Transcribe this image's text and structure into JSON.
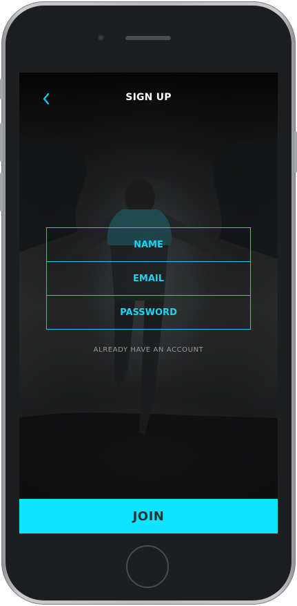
{
  "header": {
    "title": "SIGN UP",
    "back_icon": "chevron-left-icon"
  },
  "form": {
    "name_placeholder": "NAME",
    "email_placeholder": "EMAIL",
    "password_placeholder": "PASSWORD"
  },
  "already_account_link": "ALREADY HAVE AN ACCOUNT",
  "join_button": "JOIN",
  "colors": {
    "accent": "#0ee4ff",
    "field_border": "#12c9e8",
    "field_text": "#1ed3f2",
    "screen_background": "#1b1c1d",
    "device_frame": "#1d1e20"
  }
}
